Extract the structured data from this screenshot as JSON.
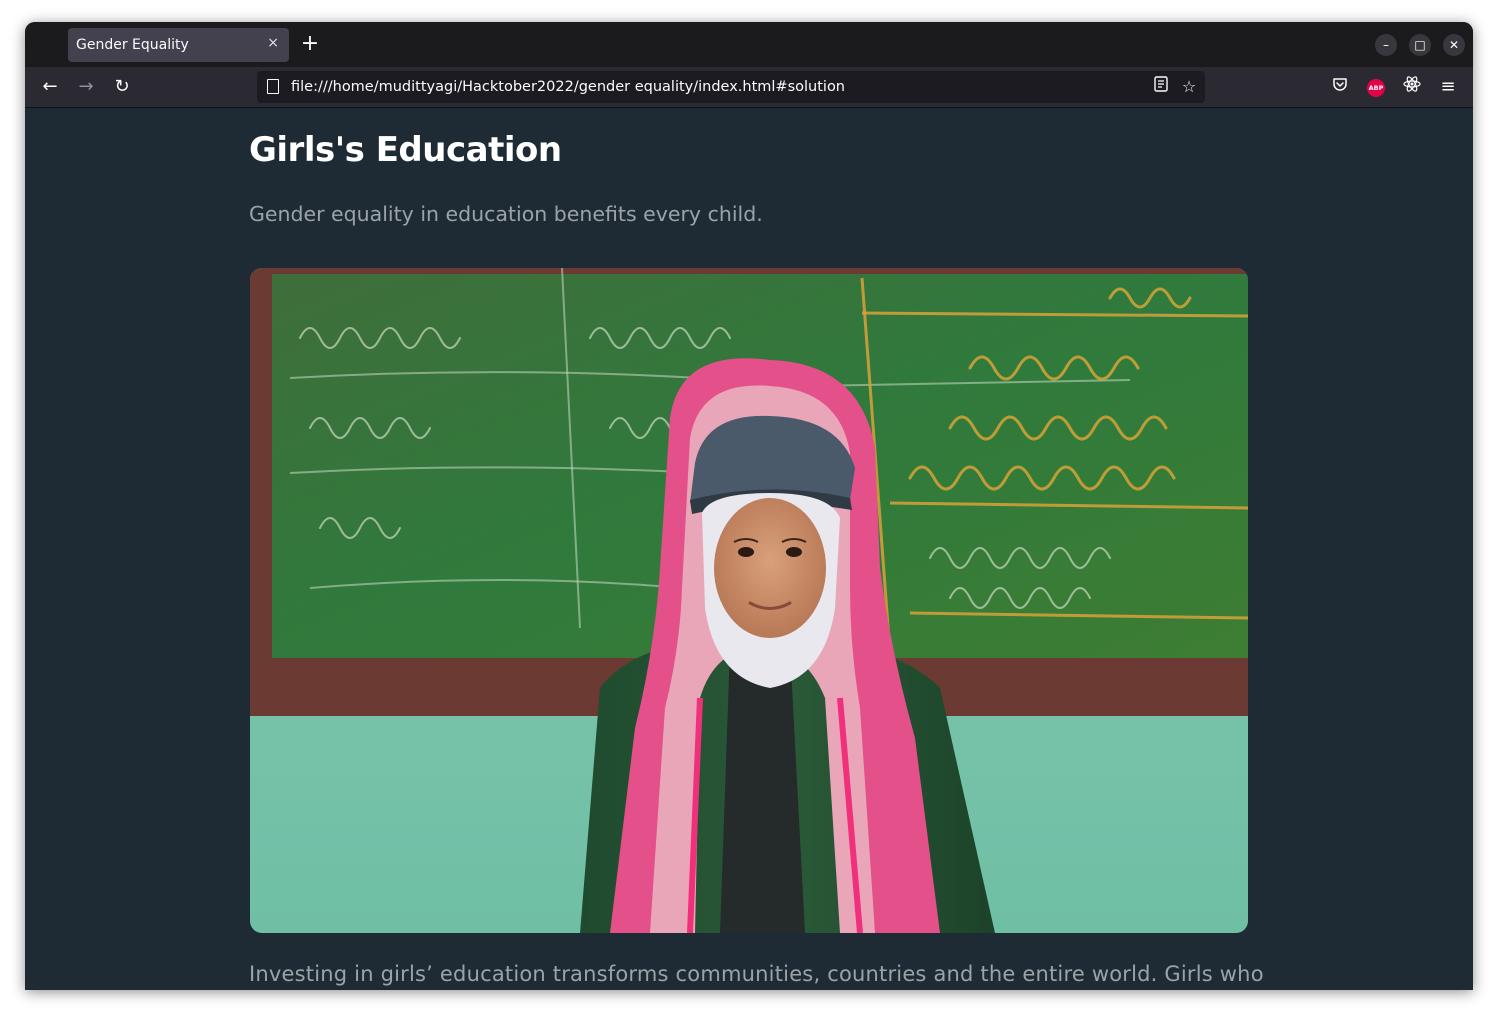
{
  "browser": {
    "tab_title": "Gender Equality",
    "tab_close_icon": "×",
    "new_tab_icon": "+",
    "url": "file:///home/mudittyagi/Hacktober2022/gender equality/index.html#solution"
  },
  "page": {
    "heading": "Girls's Education",
    "subtitle": "Gender equality in education benefits every child.",
    "image_alt": "Girl in pink hooded jacket standing in front of a green chalkboard",
    "body_text": "Investing in girls’ education transforms communities, countries and the entire world. Girls who"
  },
  "colors": {
    "page_background": "#1f2b34",
    "heading": "#ffffff",
    "muted_text": "#9ba3a8",
    "tabbar": "#1b1b1d",
    "navbar": "#2b2a33",
    "abp_red": "#e40046"
  }
}
